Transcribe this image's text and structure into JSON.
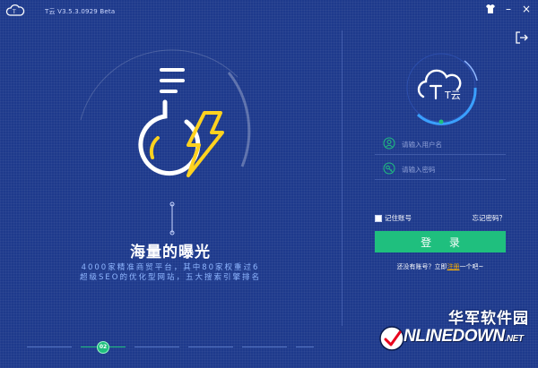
{
  "app": {
    "title": "T云 V3.5.3.0929 Beta"
  },
  "hero": {
    "title": "海量的曝光",
    "subtitle_line1": "4000家精准商贸平台，其中80家权重过6",
    "subtitle_line2": "超级SEO的优化型网站，五大搜索引擎排名",
    "active_page": "02"
  },
  "logo": {
    "text": "T云"
  },
  "login": {
    "username_placeholder": "请输入用户名",
    "password_placeholder": "请输入密码",
    "remember_label": "记住账号",
    "forgot_label": "忘记密码？",
    "login_button": "登 录",
    "no_account_text": "还没有账号？立即",
    "register_link": "注册",
    "register_suffix": "一个吧~"
  },
  "watermark": {
    "cn": "华军软件园",
    "en_main": "NLINEDOWN",
    "en_suffix": ".NET"
  },
  "colors": {
    "background": "#1e3a8c",
    "accent_green": "#1fbf7e",
    "accent_yellow": "#ffd21f",
    "link_orange": "#ffb200"
  }
}
